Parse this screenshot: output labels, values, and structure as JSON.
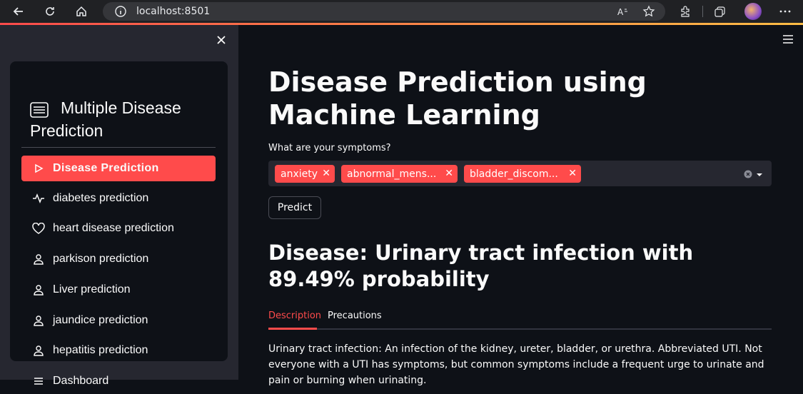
{
  "browser": {
    "url": "localhost:8501",
    "icons": [
      "back-arrow-icon",
      "reload-icon",
      "home-icon",
      "info-icon",
      "read-aloud-icon",
      "favorite-icon",
      "extensions-icon",
      "collections-icon",
      "more-icon"
    ]
  },
  "sidebar": {
    "title": "Multiple Disease Prediction",
    "items": [
      {
        "label": "Disease Prediction",
        "icon": "play-icon",
        "active": true
      },
      {
        "label": "diabetes prediction",
        "icon": "activity-icon"
      },
      {
        "label": "heart disease prediction",
        "icon": "heart-icon"
      },
      {
        "label": "parkison prediction",
        "icon": "person-icon"
      },
      {
        "label": "Liver prediction",
        "icon": "person-icon"
      },
      {
        "label": "jaundice prediction",
        "icon": "person-icon"
      },
      {
        "label": "hepatitis prediction",
        "icon": "person-icon"
      },
      {
        "label": "Dashboard",
        "icon": "list-icon"
      }
    ]
  },
  "main": {
    "title": "Disease Prediction using Machine Learning",
    "symptoms_label": "What are your symptoms?",
    "selected_symptoms": [
      "anxiety",
      "abnormal_mens...",
      "bladder_discom..."
    ],
    "predict_label": "Predict",
    "result": "Disease: Urinary tract infection with 89.49% probability",
    "tabs": [
      "Description",
      "Precautions"
    ],
    "description": "Urinary tract infection: An infection of the kidney, ureter, bladder, or urethra. Abbreviated UTI. Not everyone with a UTI has symptoms, but common symptoms include a frequent urge to urinate and pain or burning when urinating."
  },
  "colors": {
    "accent": "#ff4b4b",
    "background": "#0e1117",
    "sidebar": "#262730"
  }
}
